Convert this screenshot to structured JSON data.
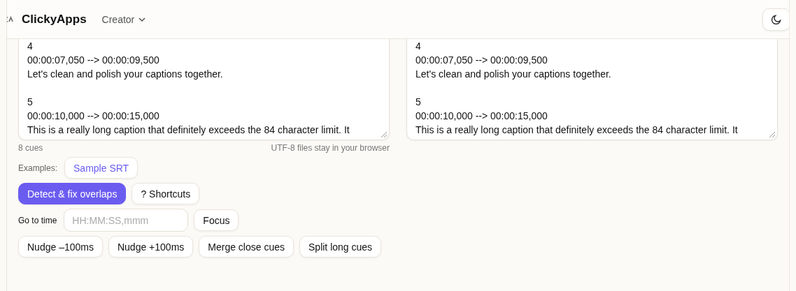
{
  "header": {
    "brand": "ClickyApps",
    "menu": "Creator"
  },
  "editors": [
    {
      "cues": [
        {
          "number": "4",
          "timing": "00:00:07,050 --> 00:00:09,500",
          "text": "Let's clean and polish your captions together."
        },
        {
          "number": "5",
          "timing": "00:00:10,000 --> 00:00:15,000",
          "text": "This is a really long caption that definitely exceeds the 84 character limit. It"
        }
      ]
    },
    {
      "cues": [
        {
          "number": "4",
          "timing": "00:00:07,050 --> 00:00:09,500",
          "text": "Let's clean and polish your captions together."
        },
        {
          "number": "5",
          "timing": "00:00:10,000 --> 00:00:15,000",
          "text": "This is a really long caption that definitely exceeds the 84 character limit. It"
        }
      ]
    }
  ],
  "cue_count": "8 cues",
  "privacy_note": "UTF-8 files stay in your browser",
  "examples": {
    "label": "Examples:",
    "items": [
      "Sample SRT"
    ]
  },
  "actions": [
    {
      "label": "Detect & fix overlaps",
      "primary": true
    },
    {
      "label": "? Shortcuts",
      "primary": false
    }
  ],
  "goto": {
    "label": "Go to time",
    "placeholder": "HH:MM:SS,mmm",
    "button": "Focus"
  },
  "tools": [
    "Nudge –100ms",
    "Nudge +100ms",
    "Merge close cues",
    "Split long cues"
  ]
}
